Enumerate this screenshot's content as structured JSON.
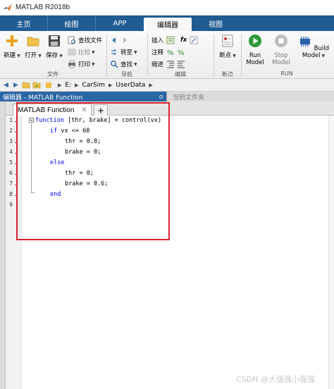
{
  "window": {
    "title": "MATLAB R2018b"
  },
  "ribbon_tabs": [
    {
      "label": "主页"
    },
    {
      "label": "绘图"
    },
    {
      "label": "APP"
    },
    {
      "label": "编辑器"
    },
    {
      "label": "视图"
    }
  ],
  "ribbon": {
    "file": {
      "new": "新建",
      "open": "打开",
      "save": "保存",
      "find_files": "查找文件",
      "compare": "比较",
      "print": "打印",
      "section": "文件"
    },
    "navigate": {
      "goto": "转至",
      "find": "查找",
      "section": "导航"
    },
    "edit": {
      "insert": "插入",
      "comment": "注释",
      "indent": "缩进",
      "fx": "fx",
      "section": "编辑"
    },
    "breakpoints": {
      "label": "断点",
      "section": "断点"
    },
    "run": {
      "run": "Run\nModel",
      "stop": "Stop\nModel",
      "build": "Build Model",
      "section": "RUN"
    }
  },
  "address": {
    "drive": "E:",
    "parts": [
      "CarSim",
      "UserData"
    ]
  },
  "panel": {
    "title": "编辑器 - MATLAB Function",
    "right_title": "当前文件夹"
  },
  "doc_tabs": [
    {
      "label": "MATLAB Function"
    }
  ],
  "code": {
    "line_numbers": [
      "1",
      "2",
      "3",
      "4",
      "5",
      "6",
      "7",
      "8",
      "9"
    ],
    "lines": [
      {
        "kw": "function",
        "rest": " [thr, brake] = control(vx)",
        "indent": 0
      },
      {
        "kw": "if",
        "rest": " vx <= 60",
        "indent": 1
      },
      {
        "kw": "",
        "rest": "thr = 0.8;",
        "indent": 2
      },
      {
        "kw": "",
        "rest": "brake = 0;",
        "indent": 2
      },
      {
        "kw": "else",
        "rest": "",
        "indent": 1
      },
      {
        "kw": "",
        "rest": "thr = 0;",
        "indent": 2
      },
      {
        "kw": "",
        "rest": "brake = 0.6;",
        "indent": 2
      },
      {
        "kw": "end",
        "rest": "",
        "indent": 1
      }
    ]
  },
  "watermark": "CSDN @大强强小强强",
  "colors": {
    "tabbar": "#1e5c93",
    "keyword": "#0000ff",
    "highlight": "#d9232d",
    "panel_header": "#2966a3"
  }
}
